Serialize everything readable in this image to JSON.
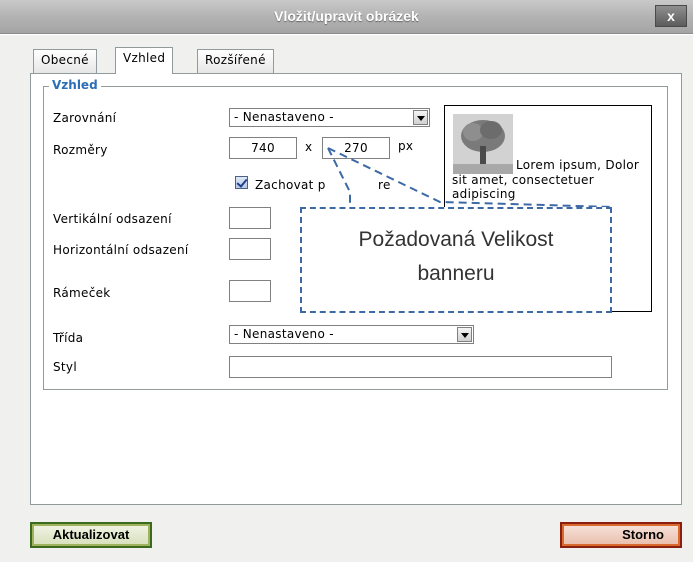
{
  "window": {
    "title": "Vložit/upravit obrázek",
    "close_label": "x"
  },
  "tabs": [
    {
      "label": "Obecné",
      "active": false
    },
    {
      "label": "Vzhled",
      "active": true
    },
    {
      "label": "Rozšířené",
      "active": false
    }
  ],
  "appearance": {
    "legend": "Vzhled",
    "alignment": {
      "label": "Zarovnání",
      "value": "- Nenastaveno -"
    },
    "dimensions": {
      "label": "Rozměry",
      "width": "740",
      "separator": "x",
      "height": "270",
      "unit": "px"
    },
    "constrain": {
      "label": "Zachovat p",
      "label_tail": "re",
      "checked": true
    },
    "vspace": {
      "label": "Vertikální odsazení",
      "value": ""
    },
    "hspace": {
      "label": "Horizontální odsazení",
      "value": ""
    },
    "border": {
      "label": "Rámeček",
      "value": ""
    },
    "class": {
      "label": "Třída",
      "value": "- Nenastaveno -"
    },
    "style": {
      "label": "Styl",
      "value": ""
    }
  },
  "preview": {
    "text": "Lorem ipsum, Dolor sit amet, consectetuer adipiscing"
  },
  "callout": {
    "line1": "Požadovaná Velikost",
    "line2": "banneru"
  },
  "buttons": {
    "update": "Aktualizovat",
    "cancel": "Storno"
  },
  "colors": {
    "legend": "#2b6fb6",
    "callout_border": "#3d6aa5"
  }
}
